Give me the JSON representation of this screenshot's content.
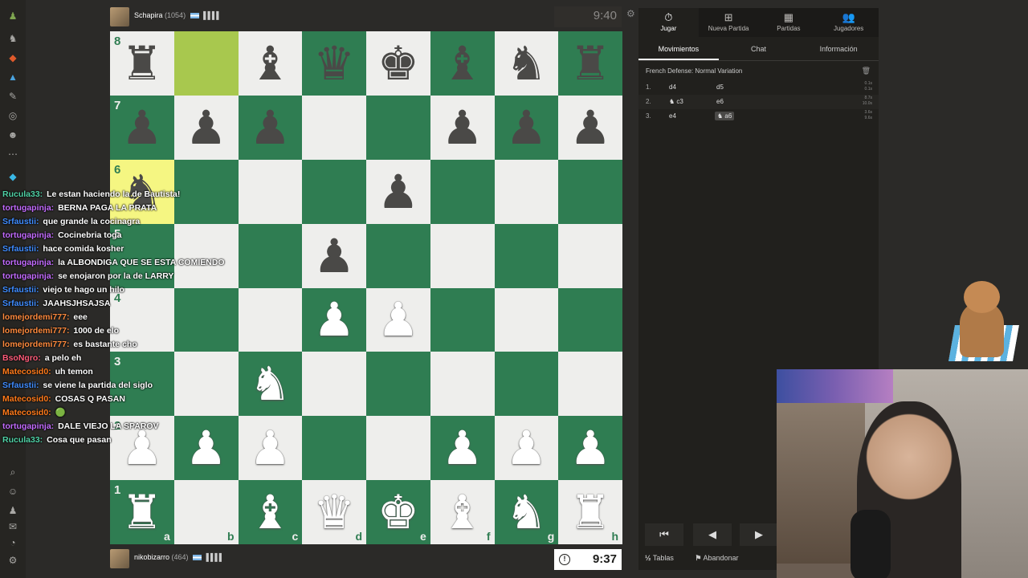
{
  "players": {
    "top": {
      "name": "Schapira",
      "rating": "(1054)",
      "signal": "▌▌▌▌",
      "clock": "9:40"
    },
    "bottom": {
      "name": "nikobizarro",
      "rating": "(464)",
      "signal": "▌▌▌▌",
      "clock": "9:37"
    }
  },
  "board": {
    "rank_labels": [
      "8",
      "7",
      "6",
      "5",
      "4",
      "3",
      "2",
      "1"
    ],
    "file_labels": [
      "a",
      "b",
      "c",
      "d",
      "e",
      "f",
      "g",
      "h"
    ],
    "highlight_squares": [
      "a6",
      "b8"
    ],
    "pieces": {
      "a8": "br",
      "c8": "bb",
      "d8": "bq",
      "e8": "bk",
      "f8": "bb",
      "g8": "bn",
      "h8": "br",
      "a7": "bp",
      "b7": "bp",
      "c7": "bp",
      "f7": "bp",
      "g7": "bp",
      "h7": "bp",
      "a6": "bn",
      "e6": "bp",
      "d5": "bp",
      "d4": "wp",
      "e4": "wp",
      "c3": "wn",
      "a2": "wp",
      "b2": "wp",
      "c2": "wp",
      "f2": "wp",
      "g2": "wp",
      "h2": "wp",
      "a1": "wr",
      "c1": "wb",
      "d1": "wq",
      "e1": "wk",
      "f1": "wb",
      "g1": "wn",
      "h1": "wr"
    },
    "glyphs": {
      "k": "♚",
      "q": "♛",
      "r": "♜",
      "b": "♝",
      "n": "♞",
      "p": "♟"
    }
  },
  "panel": {
    "tabs": [
      {
        "label": "Jugar",
        "icon": "⏱"
      },
      {
        "label": "Nueva Partida",
        "icon": "⊞"
      },
      {
        "label": "Partidas",
        "icon": "▦"
      },
      {
        "label": "Jugadores",
        "icon": "👥"
      }
    ],
    "sub_tabs": [
      "Movimientos",
      "Chat",
      "Información"
    ],
    "opening": "French Defense: Normal Variation",
    "moves": [
      {
        "num": "1.",
        "white": "d4",
        "black": "d5",
        "time_w": "0.1s",
        "time_b": "0.1s"
      },
      {
        "num": "2.",
        "white": "♞ c3",
        "black": "e6",
        "time_w": "8.7s",
        "time_b": "10.0s"
      },
      {
        "num": "3.",
        "white": "e4",
        "black": "♞ a6",
        "time_w": "3.6s",
        "time_b": "9.6s"
      }
    ],
    "footer": {
      "draw": "Tablas",
      "resign": "Abandonar",
      "draw_icon": "½",
      "resign_icon": "⚑"
    }
  },
  "chat": [
    {
      "user": "Rucula33",
      "color": "#4fd1a5",
      "msg": "Le estan haciendo la de Bautista!"
    },
    {
      "user": "tortugapinja",
      "color": "#c36bff",
      "msg": "BERNA PAGA LA PRATA"
    },
    {
      "user": "Srfaustii",
      "color": "#3f8cff",
      "msg": "que grande la cocinagra"
    },
    {
      "user": "tortugapinja",
      "color": "#c36bff",
      "msg": "Cocinebria toga"
    },
    {
      "user": "Srfaustii",
      "color": "#3f8cff",
      "msg": "hace comida kosher"
    },
    {
      "user": "tortugapinja",
      "color": "#c36bff",
      "msg": "la ALBONDIGA QUE SE ESTA COMIENDO"
    },
    {
      "user": "tortugapinja",
      "color": "#c36bff",
      "msg": "se enojaron por la de LARRY"
    },
    {
      "user": "Srfaustii",
      "color": "#3f8cff",
      "msg": "viejo te hago un hilo"
    },
    {
      "user": "Srfaustii",
      "color": "#3f8cff",
      "msg": "JAAHSJHSAJSA"
    },
    {
      "user": "lomejordemi777",
      "color": "#ff8a3d",
      "msg": "eee"
    },
    {
      "user": "lomejordemi777",
      "color": "#ff8a3d",
      "msg": "1000 de elo"
    },
    {
      "user": "lomejordemi777",
      "color": "#ff8a3d",
      "msg": "es bastante cho"
    },
    {
      "user": "BsoNgro",
      "color": "#ff5c7a",
      "msg": "a pelo eh"
    },
    {
      "user": "Matecosid0",
      "color": "#ff7a1a",
      "msg": "uh temon"
    },
    {
      "user": "Srfaustii",
      "color": "#3f8cff",
      "msg": "se viene la partida del siglo"
    },
    {
      "user": "Matecosid0",
      "color": "#ff7a1a",
      "msg": "COSAS Q PASAN"
    },
    {
      "user": "Matecosid0",
      "color": "#ff7a1a",
      "msg": "🟢"
    },
    {
      "user": "tortugapinja",
      "color": "#c36bff",
      "msg": "DALE VIEJO LA SPAROV"
    },
    {
      "user": "Rucula33",
      "color": "#4fd1a5",
      "msg": "Cosa que pasan"
    }
  ]
}
